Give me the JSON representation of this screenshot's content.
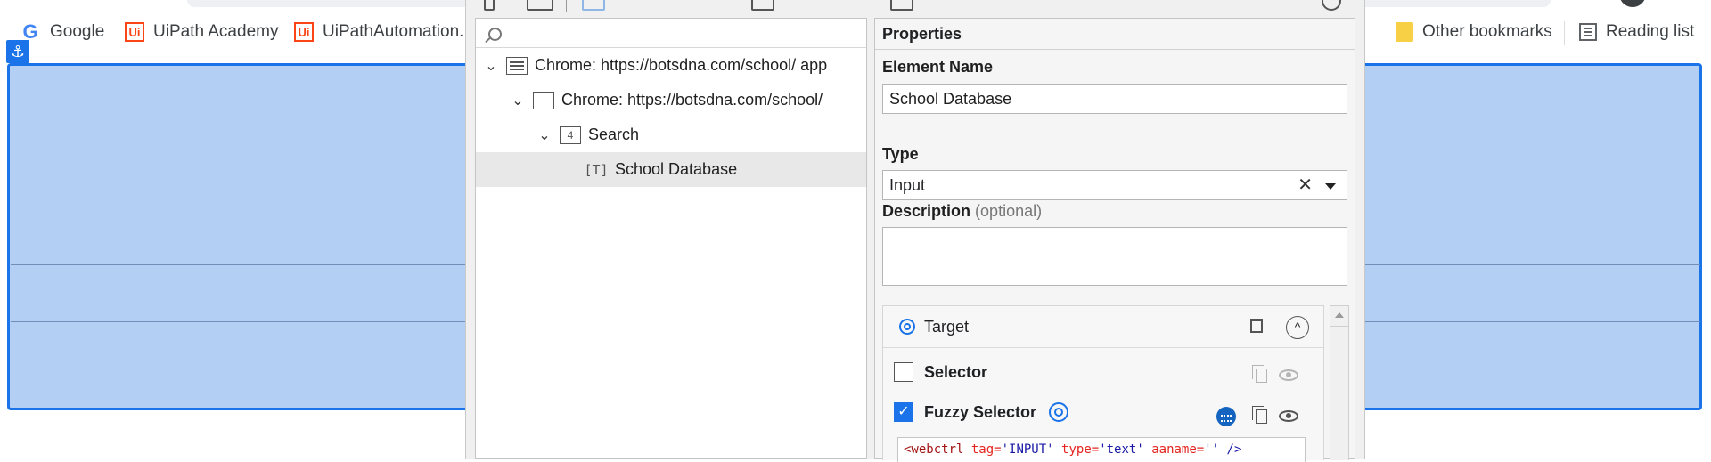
{
  "bookmarks": [
    {
      "label": "Google",
      "icon": "google-icon"
    },
    {
      "label": "UiPath Academy",
      "icon": "uipath-icon"
    },
    {
      "label": "UiPathAutomation...",
      "icon": "uipath-icon"
    },
    {
      "label": "Other bookmarks",
      "icon": "folder-icon"
    },
    {
      "label": "Reading list",
      "icon": "reading-list-icon"
    }
  ],
  "logo_text": {
    "uipath": "Ui",
    "google": "G"
  },
  "anchor_badge": "⚓",
  "tree": {
    "search_placeholder": "",
    "items": [
      {
        "label": "Chrome: https://botsdna.com/school/ app",
        "icon": "window-icon",
        "chevron": "⌄"
      },
      {
        "label": "Chrome: https://botsdna.com/school/",
        "icon": "page-icon",
        "chevron": "⌄"
      },
      {
        "label": "Search",
        "icon": "container-icon",
        "chevron": "⌄",
        "icon_glyph": "4"
      },
      {
        "label": "School Database",
        "icon": "text-input-icon",
        "icon_glyph": "[T]"
      }
    ]
  },
  "properties": {
    "header": "Properties",
    "element_name_label": "Element Name",
    "element_name_value": "School Database",
    "type_label": "Type",
    "type_value": "Input",
    "clear_glyph": "✕",
    "description_label": "Description",
    "description_optional": "(optional)",
    "description_value": ""
  },
  "target": {
    "label": "Target",
    "collapse_glyph": "^",
    "selector_label": "Selector",
    "selector_checked": false,
    "fuzzy_label": "Fuzzy Selector",
    "fuzzy_checked": true,
    "check_glyph": "✓",
    "code": {
      "tag_open": "<webctrl",
      "a1": "tag=",
      "v1": "'INPUT'",
      "a2": "type=",
      "v2": "'text'",
      "a3": "aaname=",
      "v3": "''",
      "close": "/>"
    }
  },
  "colors": {
    "highlight_fill": "#b3d0f4",
    "highlight_border": "#1a73e8",
    "accent": "#1a73e8"
  }
}
